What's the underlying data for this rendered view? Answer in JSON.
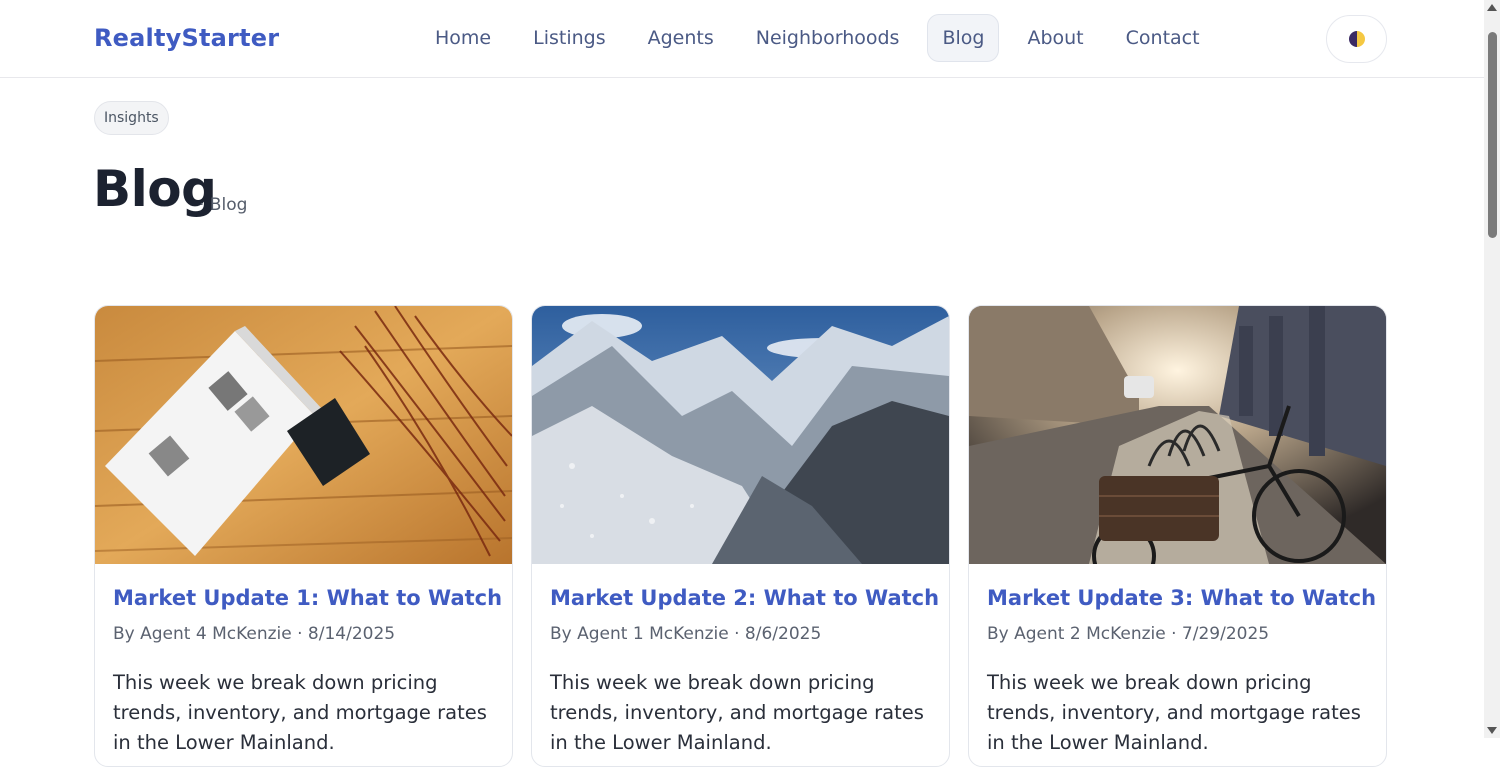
{
  "header": {
    "brand": "RealtyStarter",
    "nav": [
      "Home",
      "Listings",
      "Agents",
      "Neighborhoods",
      "Blog",
      "About",
      "Contact"
    ],
    "active_nav": "Blog",
    "theme_toggle_icon": "half-moon-icon"
  },
  "page": {
    "badge": "Insights",
    "title": "Blog",
    "subtitle": "· Blog"
  },
  "posts": [
    {
      "title": "Market Update 1: What to Watch",
      "meta": "By Agent 4 McKenzie · 8/14/2025",
      "excerpt": "This week we break down pricing trends, inventory, and mortgage rates in the Lower Mainland.",
      "image": "open-magazine-on-wooden-table"
    },
    {
      "title": "Market Update 2: What to Watch",
      "meta": "By Agent 1 McKenzie · 8/6/2025",
      "excerpt": "This week we break down pricing trends, inventory, and mortgage rates in the Lower Mainland.",
      "image": "snowy-mountain-valley"
    },
    {
      "title": "Market Update 3: What to Watch",
      "meta": "By Agent 2 McKenzie · 7/29/2025",
      "excerpt": "This week we break down pricing trends, inventory, and mortgage rates in the Lower Mainland.",
      "image": "street-with-bicycle"
    }
  ],
  "colors": {
    "brand": "#3f5bc2",
    "nav_text": "#4b5a85",
    "heading": "#1c2230",
    "border": "#e3e6ec"
  }
}
